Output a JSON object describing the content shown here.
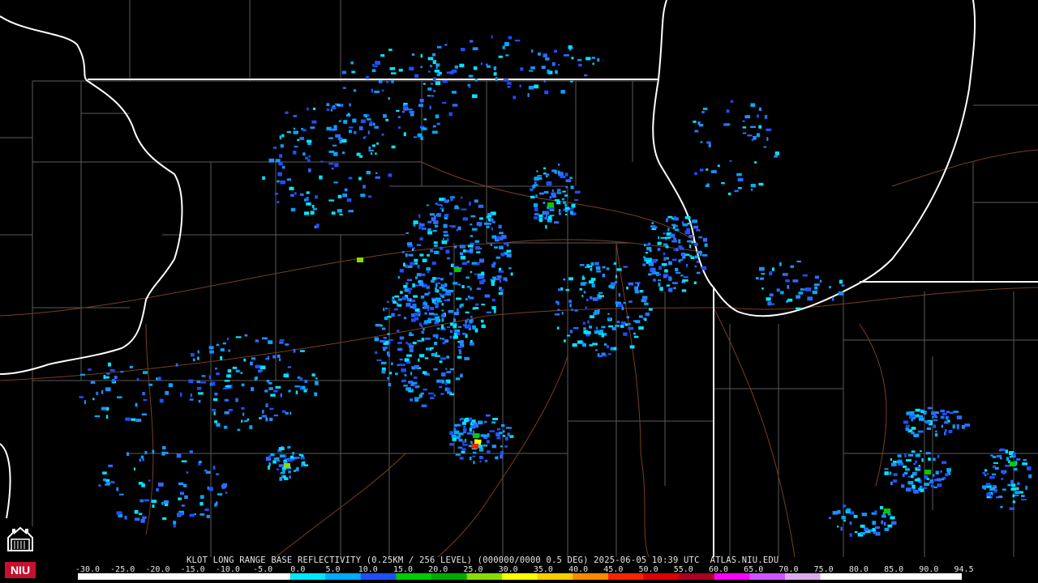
{
  "product_title": "KLOT LONG RANGE BASE REFLECTIVITY (0.25KM / 256 LEVEL) (000000/0000 0.5 DEG) 2025-06-05 10:39 UTC  ATLAS.NIU.EDU",
  "logo_text": "NIU",
  "scale": {
    "labels": [
      "-30.0",
      "-25.0",
      "-20.0",
      "-15.0",
      "-10.0",
      "-5.0",
      "0.0",
      "5.0",
      "10.0",
      "15.0",
      "20.0",
      "25.0",
      "30.0",
      "35.0",
      "40.0",
      "45.0",
      "50.0",
      "55.0",
      "60.0",
      "65.0",
      "70.0",
      "75.0",
      "80.0",
      "85.0",
      "90.0",
      "94.5"
    ],
    "colors": [
      "#ffffff",
      "#ffffff",
      "#ffffff",
      "#ffffff",
      "#ffffff",
      "#ffffff",
      "#00e5ff",
      "#00aaff",
      "#1f4fff",
      "#00cc00",
      "#00aa00",
      "#88dd00",
      "#ffff00",
      "#ffcc00",
      "#ff8800",
      "#ff2200",
      "#dd0000",
      "#aa0022",
      "#ff00ff",
      "#cc55ff",
      "#ddaaee",
      "#ffffff",
      "#ffffff",
      "#ffffff",
      "#ffffff"
    ]
  },
  "colors": {
    "state_border": "#ffffff",
    "county_line": "#6e6e6e",
    "highway": "#8a4a2a",
    "background": "#000000"
  }
}
